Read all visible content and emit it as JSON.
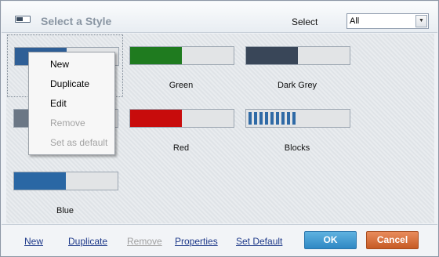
{
  "header": {
    "title": "Select a Style",
    "select_label": "Select",
    "dropdown_value": "All",
    "dropdown_arrow": "▼"
  },
  "styles": [
    {
      "label": "",
      "fill_color": "#2f5f96",
      "fill_fraction": 0.5
    },
    {
      "label": "Green",
      "fill_color": "#1f7b1f",
      "fill_fraction": 0.5
    },
    {
      "label": "Dark Grey",
      "fill_color": "#394658",
      "fill_fraction": 0.5
    },
    {
      "label": "",
      "fill_color": "#6b7785",
      "fill_fraction": 0.5
    },
    {
      "label": "Red",
      "fill_color": "#c80c0c",
      "fill_fraction": 0.5
    },
    {
      "label": "Blocks",
      "fill_color": "#2f6aa6",
      "fill_fraction": 0.5
    },
    {
      "label": "Blue",
      "fill_color": "#2a67a4",
      "fill_fraction": 0.5
    }
  ],
  "context_menu": {
    "items": [
      {
        "label": "New",
        "enabled": true
      },
      {
        "label": "Duplicate",
        "enabled": true
      },
      {
        "label": "Edit",
        "enabled": true
      },
      {
        "label": "Remove",
        "enabled": false
      },
      {
        "label": "Set as default",
        "enabled": false
      }
    ]
  },
  "footer": {
    "links": [
      {
        "label": "New",
        "enabled": true
      },
      {
        "label": "Duplicate",
        "enabled": true
      },
      {
        "label": "Remove",
        "enabled": false
      },
      {
        "label": "Properties",
        "enabled": true
      },
      {
        "label": "Set Default",
        "enabled": true
      }
    ],
    "ok_label": "OK",
    "cancel_label": "Cancel"
  }
}
